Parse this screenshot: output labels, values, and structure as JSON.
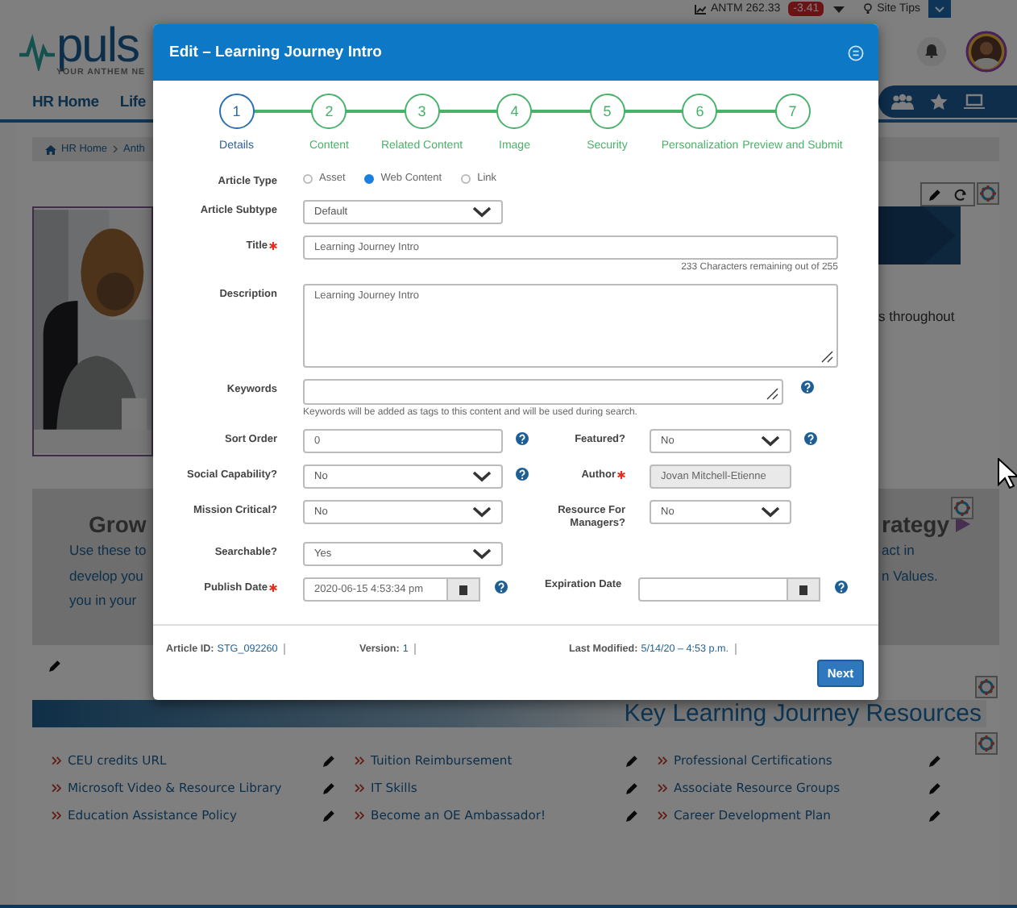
{
  "top_bar": {
    "ticker": "ANTM 262.33",
    "change": "-3.41",
    "site_tips": "Site Tips"
  },
  "logo": {
    "name": "puls",
    "tagline": "YOUR ANTHEM NE"
  },
  "nav": {
    "items": [
      "HR Home",
      "Life"
    ]
  },
  "breadcrumb": [
    "HR Home",
    "Anth"
  ],
  "hero": {
    "text": "s throughout"
  },
  "grow_panel": {
    "heading": "Grow",
    "lines": [
      "Use these to",
      "develop you",
      "you in your"
    ],
    "heading_right": "rategy",
    "lines_right": [
      "act in",
      "n Values."
    ]
  },
  "resources": {
    "title": "Key Learning Journey Resources",
    "columns": [
      [
        "CEU credits URL",
        "Microsoft Video & Resource Library",
        "Education Assistance Policy"
      ],
      [
        "Tuition Reimbursement",
        "IT Skills",
        "Become an OE Ambassador!"
      ],
      [
        "Professional Certifications",
        "Associate Resource Groups",
        "Career Development Plan"
      ]
    ]
  },
  "modal": {
    "title": "Edit – Learning Journey Intro",
    "steps": [
      {
        "number": "1",
        "label": "Details",
        "selected": true
      },
      {
        "number": "2",
        "label": "Content",
        "selected": false
      },
      {
        "number": "3",
        "label": "Related Content",
        "selected": false
      },
      {
        "number": "4",
        "label": "Image",
        "selected": false
      },
      {
        "number": "5",
        "label": "Security",
        "selected": false
      },
      {
        "number": "6",
        "label": "Personalization",
        "selected": false
      },
      {
        "number": "7",
        "label": "Preview and Submit",
        "selected": false
      }
    ],
    "rows": [
      [
        {
          "label": "Article Type",
          "kind": "radio",
          "required": false,
          "help": false,
          "options": [
            {
              "label": "Asset",
              "selected": false
            },
            {
              "label": "Web Content",
              "selected": true
            },
            {
              "label": "Link",
              "selected": false
            }
          ]
        }
      ],
      [
        {
          "label": "Article Subtype",
          "kind": "select",
          "required": false,
          "help": false,
          "value": "Default"
        }
      ],
      [
        {
          "label": "Title",
          "kind": "long-text",
          "required": true,
          "help": false,
          "value": "Learning Journey Intro",
          "note": "233 Characters remaining out of 255"
        }
      ],
      [
        {
          "label": "Description",
          "kind": "textarea",
          "required": false,
          "help": false,
          "value": "Learning Journey Intro"
        }
      ],
      [
        {
          "label": "Keywords",
          "kind": "tag-area",
          "required": false,
          "help": true,
          "note": "Keywords will be added as tags to this content and will be used during search."
        }
      ],
      [
        {
          "label": "Sort Order",
          "kind": "text",
          "required": false,
          "help": true,
          "value": "0"
        },
        {
          "label": "Featured?",
          "kind": "select",
          "required": false,
          "help": true,
          "value": "No"
        }
      ],
      [
        {
          "label": "Social Capability?",
          "kind": "select",
          "required": false,
          "help": true,
          "value": "No"
        },
        {
          "label": "Author",
          "kind": "readonly",
          "required": true,
          "help": false,
          "value": "Jovan Mitchell-Etienne"
        }
      ],
      [
        {
          "label": "Mission Critical?",
          "kind": "select",
          "required": false,
          "help": false,
          "value": "No"
        },
        {
          "label": "Resource For Managers?",
          "kind": "select",
          "required": false,
          "help": false,
          "value": "No"
        }
      ],
      [
        {
          "label": "Searchable?",
          "kind": "select",
          "required": false,
          "help": false,
          "value": "Yes"
        }
      ],
      [
        {
          "label": "Publish Date",
          "kind": "date",
          "required": true,
          "help": true,
          "value": "2020-06-15 4:53:34 pm"
        },
        {
          "label": "Expiration Date",
          "kind": "date",
          "required": false,
          "help": true
        }
      ]
    ],
    "footer": [
      {
        "label": "Article ID:",
        "value": "STG_092260"
      },
      {
        "label": "Version:",
        "value": "1"
      },
      {
        "label": "Last Modified:",
        "value": "5/14/20 – 4:53 p.m."
      }
    ],
    "next_button": "Next"
  }
}
